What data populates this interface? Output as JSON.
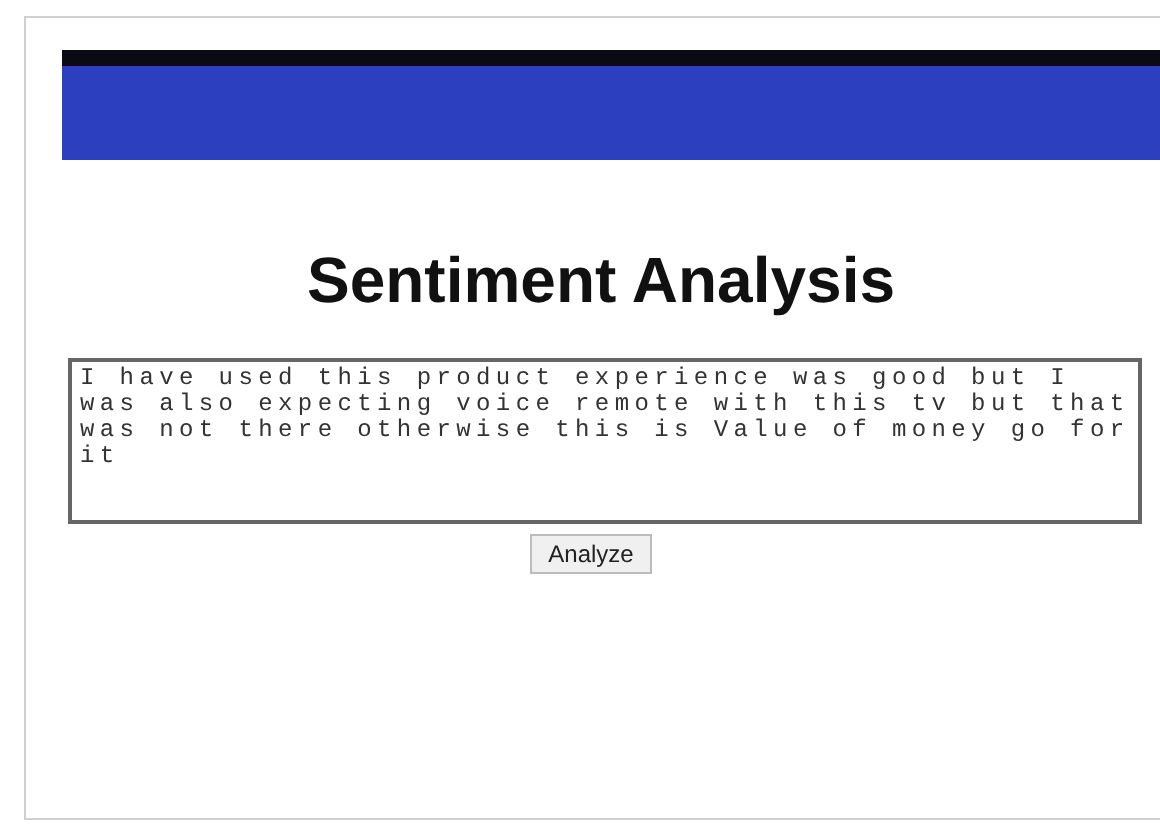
{
  "header": {
    "kind": "bar"
  },
  "title": "Sentiment Analysis",
  "review": {
    "value": "I have used this product experience was good but I was also expecting voice remote with this tv but that was not there otherwise this is Value of money go for it"
  },
  "analyze_button": "Analyze"
}
